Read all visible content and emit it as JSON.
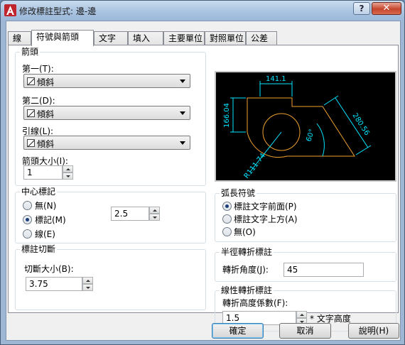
{
  "window": {
    "title": "修改標註型式: 邊-邊",
    "help_label": "?",
    "close_label": "✕"
  },
  "tabs": [
    {
      "label": "線",
      "active": false
    },
    {
      "label": "符號與箭頭",
      "active": true
    },
    {
      "label": "文字",
      "active": false
    },
    {
      "label": "填入",
      "active": false
    },
    {
      "label": "主要單位",
      "active": false
    },
    {
      "label": "對照單位",
      "active": false
    },
    {
      "label": "公差",
      "active": false
    }
  ],
  "arrowheads": {
    "title": "箭頭",
    "first_label": "第一(T):",
    "first_value": "傾斜",
    "second_label": "第二(D):",
    "second_value": "傾斜",
    "leader_label": "引線(L):",
    "leader_value": "傾斜",
    "size_label": "箭頭大小(I):",
    "size_value": "1"
  },
  "center_marks": {
    "title": "中心標記",
    "options": [
      "無(N)",
      "標記(M)",
      "線(E)"
    ],
    "selected_index": 1,
    "size_value": "2.5"
  },
  "dimension_break": {
    "title": "標註切斷",
    "size_label": "切斷大小(B):",
    "size_value": "3.75"
  },
  "preview": {
    "dim_top": "141.1",
    "dim_left": "166.04",
    "dim_right": "280.56",
    "dim_angle": "60°",
    "dim_radius": "R111.74"
  },
  "arc_length": {
    "title": "弧長符號",
    "options": [
      "標註文字前面(P)",
      "標註文字上方(A)",
      "無(O)"
    ],
    "selected_index": 0
  },
  "radius_jog": {
    "title": "半徑轉折標註",
    "angle_label": "轉折角度(J):",
    "angle_value": "45"
  },
  "linear_jog": {
    "title": "線性轉折標註",
    "height_label": "轉折高度係數(F):",
    "height_value": "1.5",
    "unit_label": "* 文字高度"
  },
  "buttons": {
    "ok": "確定",
    "cancel": "取消",
    "help": "說明(H)"
  },
  "colors": {
    "dimension": "#00e5ff",
    "geometry": "#f0a030",
    "selection_accent": "#3c7fb1"
  }
}
